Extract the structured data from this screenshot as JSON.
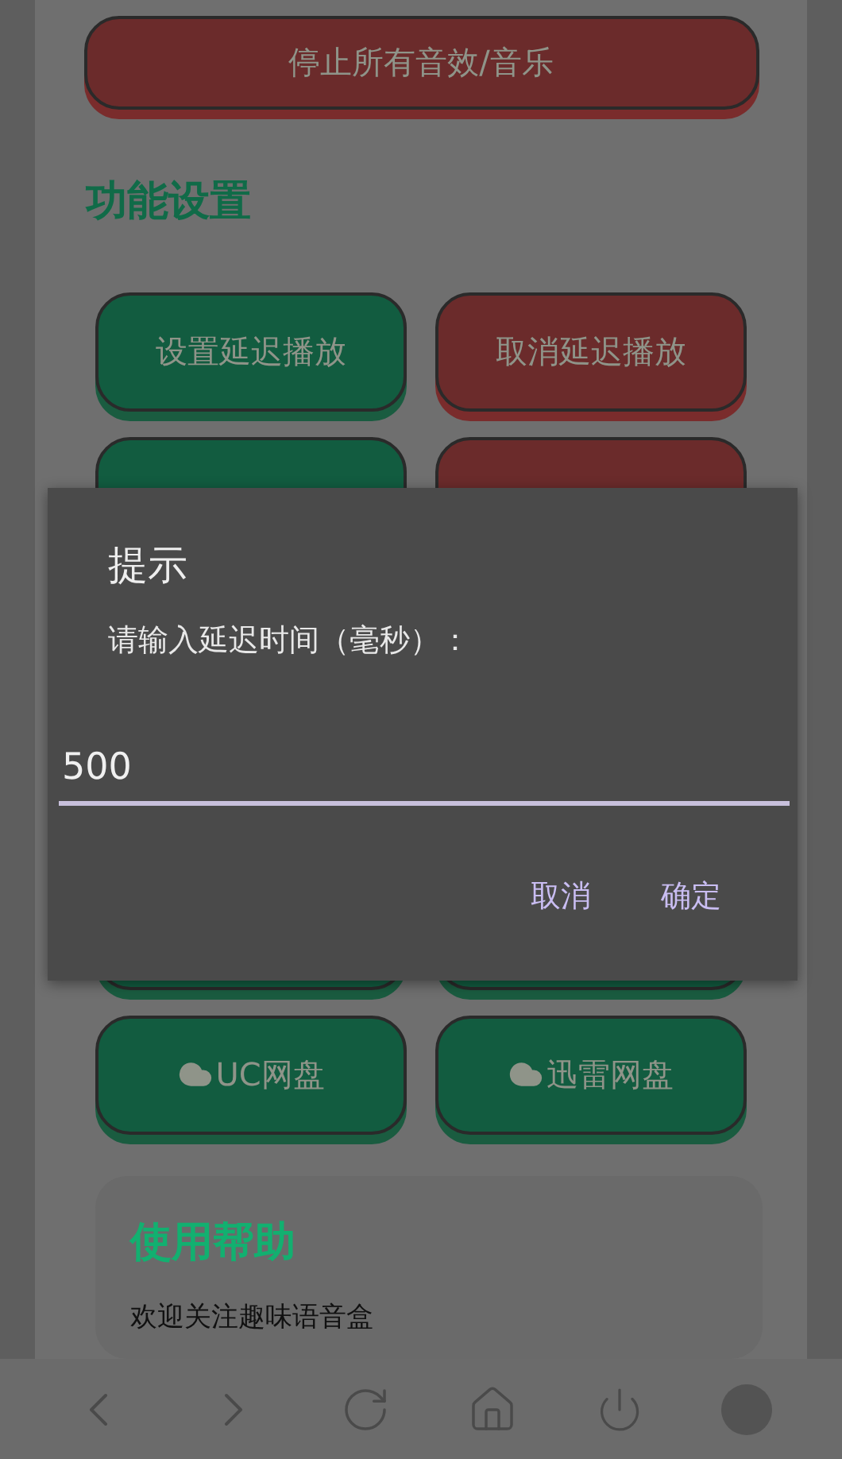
{
  "stop_button": {
    "label": "停止所有音效/音乐",
    "kind": "danger"
  },
  "settings": {
    "title": "功能设置",
    "buttons": [
      {
        "label": "设置延迟播放",
        "kind": "primary"
      },
      {
        "label": "取消延迟播放",
        "kind": "danger"
      },
      {
        "kind": "primary"
      },
      {
        "kind": "danger"
      },
      {
        "kind": "primary"
      },
      {
        "kind": "primary"
      },
      {
        "label": "UC网盘",
        "kind": "cloud"
      },
      {
        "label": "迅雷网盘",
        "kind": "cloud"
      }
    ]
  },
  "help": {
    "title": "使用帮助",
    "text": "欢迎关注趣味语音盒"
  },
  "dialog": {
    "title": "提示",
    "message": "请输入延迟时间（毫秒）：",
    "value": "500",
    "buttons": [
      "取消",
      "确定"
    ]
  }
}
